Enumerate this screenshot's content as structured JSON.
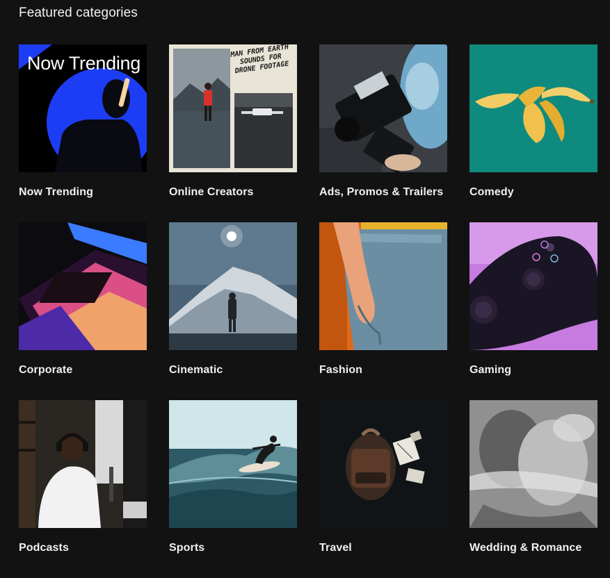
{
  "section": {
    "title": "Featured categories"
  },
  "categories": [
    {
      "label": "Now Trending",
      "thumb_text": "Now Trending",
      "colors": [
        "#0a0a0a",
        "#1d3df5"
      ]
    },
    {
      "label": "Online Creators",
      "thumb_text": "MAN FROM EARTH SOUNDS FOR DRONE FOOTAGE",
      "colors": [
        "#e9e4d8",
        "#5c6770"
      ]
    },
    {
      "label": "Ads, Promos & Trailers",
      "colors": [
        "#3b3f44",
        "#6fa8c9"
      ]
    },
    {
      "label": "Comedy",
      "colors": [
        "#0f8a7e",
        "#e8b53a"
      ]
    },
    {
      "label": "Corporate",
      "colors": [
        "#0b0b10",
        "#e04fa0"
      ]
    },
    {
      "label": "Cinematic",
      "colors": [
        "#4a6277",
        "#cfd6dc"
      ]
    },
    {
      "label": "Fashion",
      "colors": [
        "#6b8ea3",
        "#e0691d"
      ]
    },
    {
      "label": "Gaming",
      "colors": [
        "#1a1525",
        "#c77be0"
      ]
    },
    {
      "label": "Podcasts",
      "colors": [
        "#2a2622",
        "#e9e9e9"
      ]
    },
    {
      "label": "Sports",
      "colors": [
        "#2d5a66",
        "#cfe6ea"
      ]
    },
    {
      "label": "Travel",
      "colors": [
        "#111416",
        "#5b3a29"
      ]
    },
    {
      "label": "Wedding & Romance",
      "colors": [
        "#7d7d7d",
        "#d9d9d9"
      ]
    }
  ]
}
